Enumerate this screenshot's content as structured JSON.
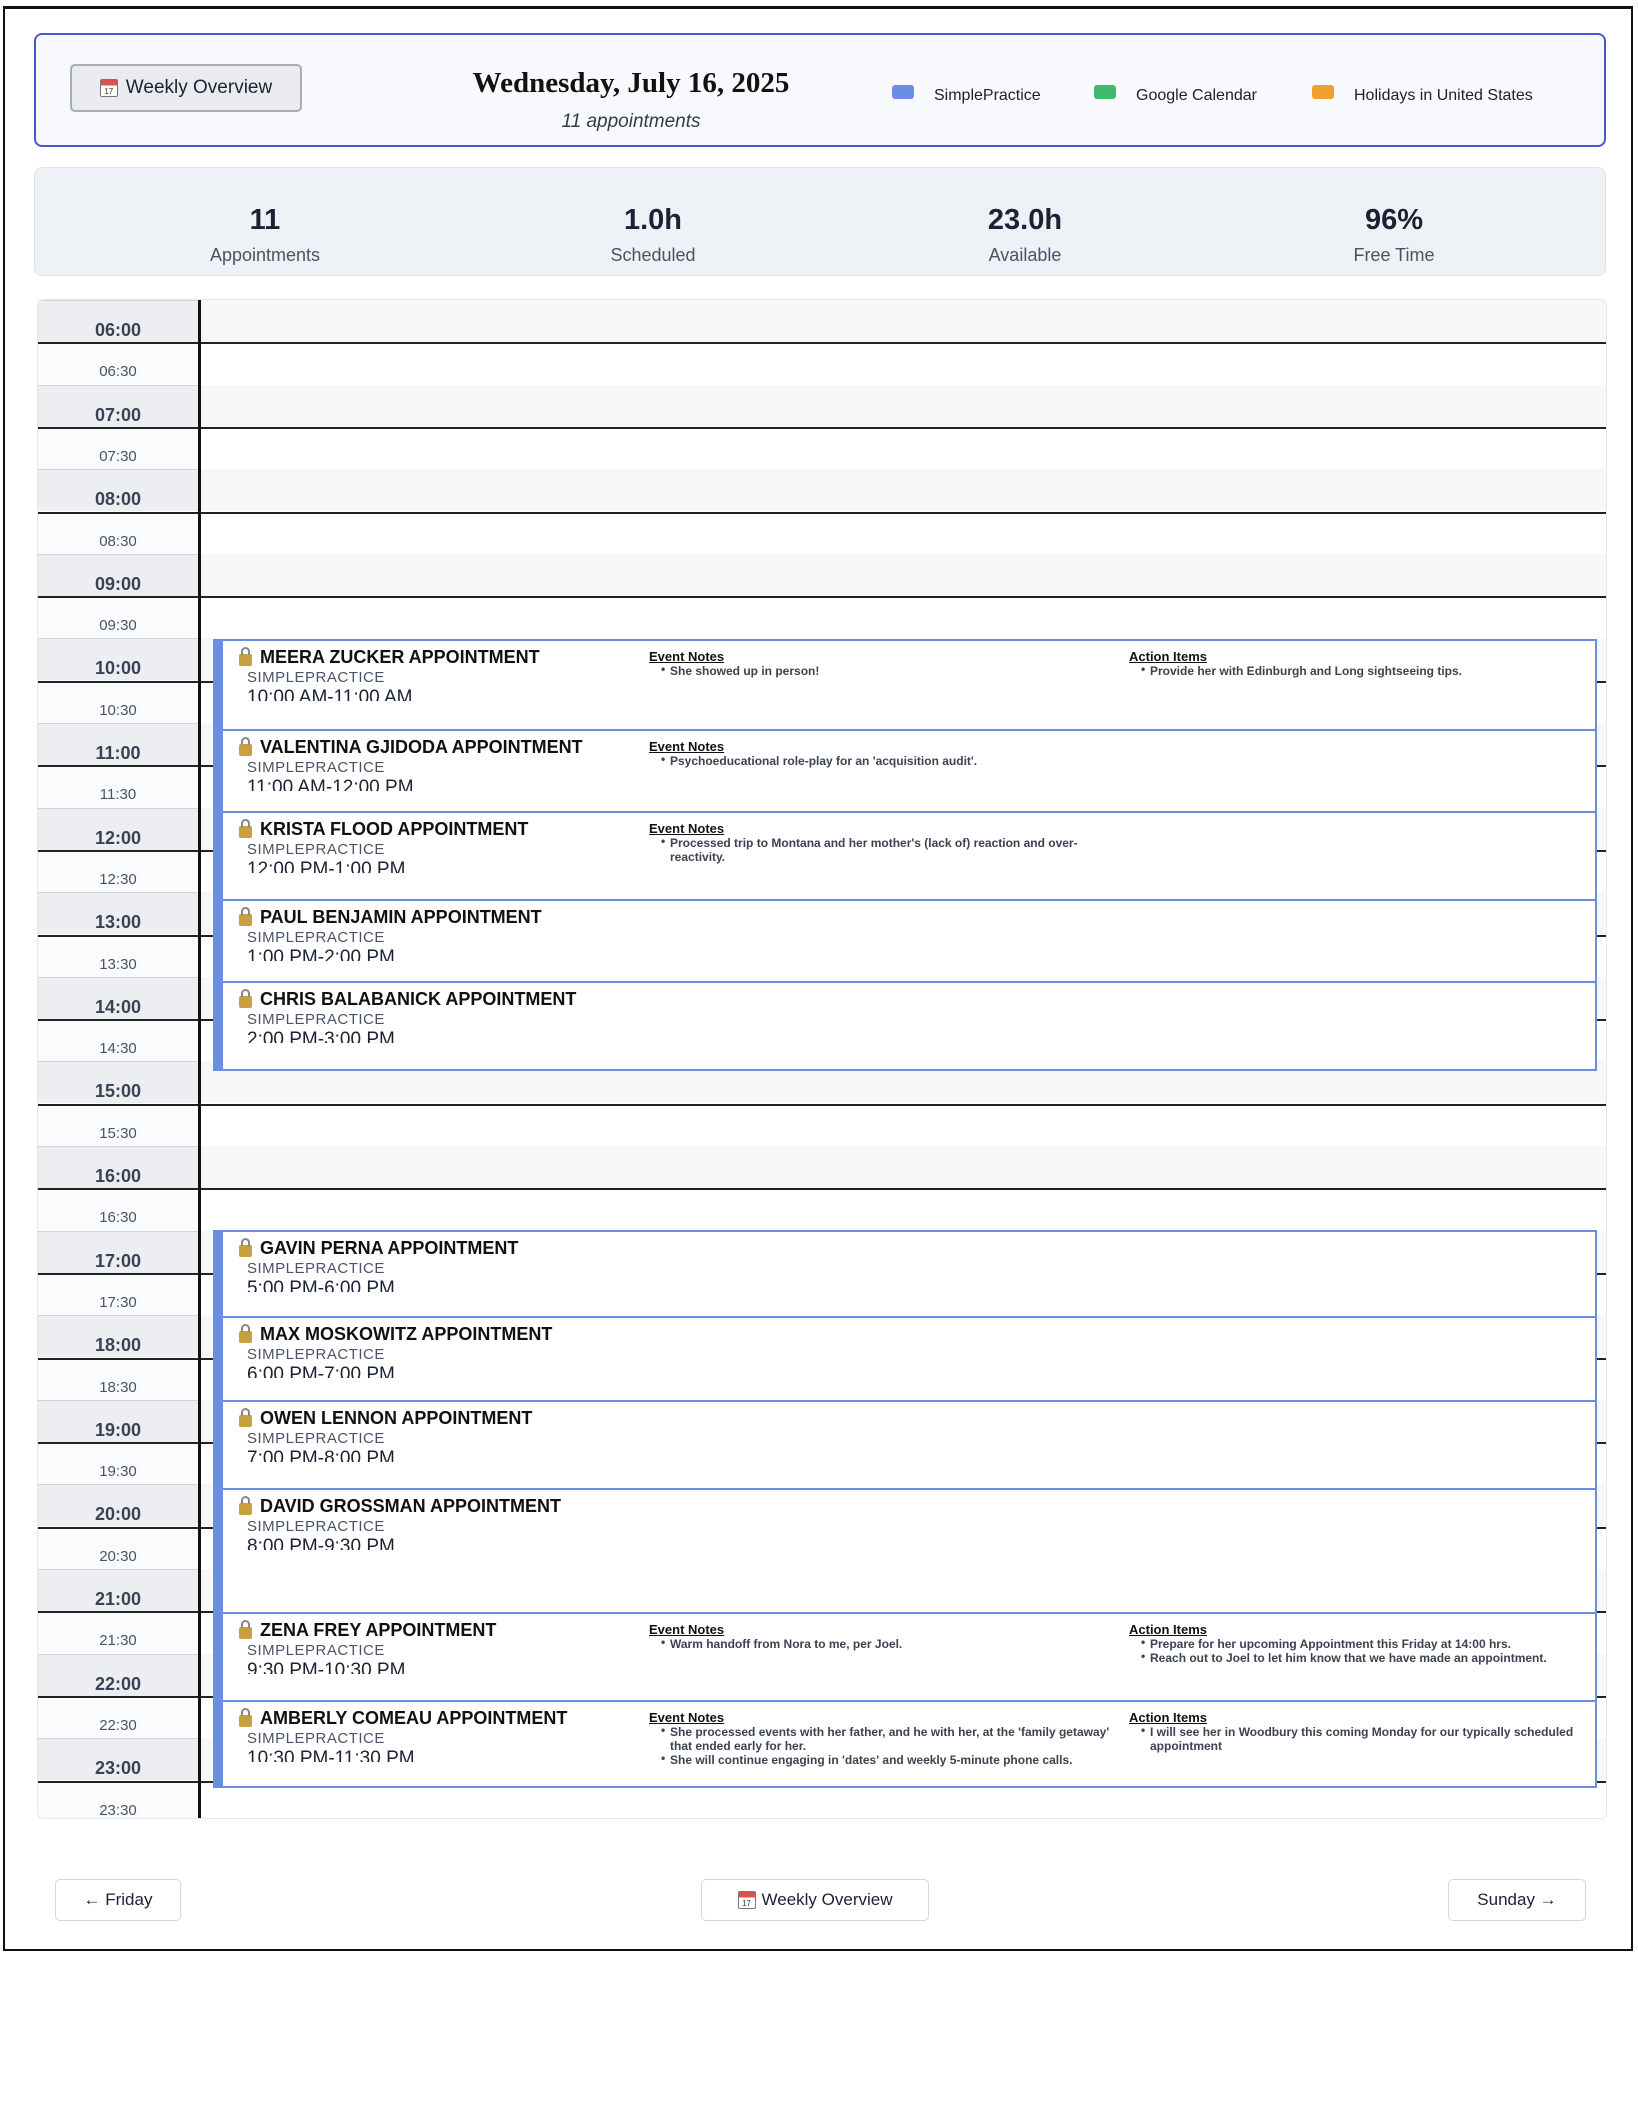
{
  "header": {
    "weekly_overview_label": "Weekly Overview",
    "date_title": "Wednesday, July 16, 2025",
    "appointment_count": "11 appointments",
    "legend": [
      {
        "label": "SimplePractice",
        "color": "#6a8ee6"
      },
      {
        "label": "Google Calendar",
        "color": "#3dba6c"
      },
      {
        "label": "Holidays in United States",
        "color": "#f0a030"
      }
    ]
  },
  "stats": [
    {
      "value": "11",
      "label": "Appointments"
    },
    {
      "value": "1.0h",
      "label": "Scheduled"
    },
    {
      "value": "23.0h",
      "label": "Available"
    },
    {
      "value": "96%",
      "label": "Free Time"
    }
  ],
  "time_slots": [
    "06:00",
    "06:30",
    "07:00",
    "07:30",
    "08:00",
    "08:30",
    "09:00",
    "09:30",
    "10:00",
    "10:30",
    "11:00",
    "11:30",
    "12:00",
    "12:30",
    "13:00",
    "13:30",
    "14:00",
    "14:30",
    "15:00",
    "15:30",
    "16:00",
    "16:30",
    "17:00",
    "17:30",
    "18:00",
    "18:30",
    "19:00",
    "19:30",
    "20:00",
    "20:30",
    "21:00",
    "21:30",
    "22:00",
    "22:30",
    "23:00",
    "23:30"
  ],
  "labels": {
    "event_notes": "Event Notes",
    "action_items": "Action Items"
  },
  "appointments": [
    {
      "title": "MEERA ZUCKER APPOINTMENT",
      "source": "SIMPLEPRACTICE",
      "time": "10:00 AM-11:00 AM",
      "event_notes": [
        "She showed up in person!"
      ],
      "action_items": [
        "Provide her with Edinburgh and Long sightseeing tips."
      ]
    },
    {
      "title": "VALENTINA GJIDODA APPOINTMENT",
      "source": "SIMPLEPRACTICE",
      "time": "11:00 AM-12:00 PM",
      "event_notes": [
        "Psychoeducational role-play for an 'acquisition audit'."
      ],
      "action_items": []
    },
    {
      "title": "KRISTA FLOOD APPOINTMENT",
      "source": "SIMPLEPRACTICE",
      "time": "12:00 PM-1:00 PM",
      "event_notes": [
        "Processed trip to Montana and her mother's (lack of) reaction and over-reactivity."
      ],
      "action_items": []
    },
    {
      "title": "PAUL BENJAMIN APPOINTMENT",
      "source": "SIMPLEPRACTICE",
      "time": "1:00 PM-2:00 PM",
      "event_notes": [],
      "action_items": []
    },
    {
      "title": "CHRIS BALABANICK APPOINTMENT",
      "source": "SIMPLEPRACTICE",
      "time": "2:00 PM-3:00 PM",
      "event_notes": [],
      "action_items": []
    },
    {
      "title": "GAVIN PERNA APPOINTMENT",
      "source": "SIMPLEPRACTICE",
      "time": "5:00 PM-6:00 PM",
      "event_notes": [],
      "action_items": []
    },
    {
      "title": "MAX MOSKOWITZ APPOINTMENT",
      "source": "SIMPLEPRACTICE",
      "time": "6:00 PM-7:00 PM",
      "event_notes": [],
      "action_items": []
    },
    {
      "title": "OWEN LENNON APPOINTMENT",
      "source": "SIMPLEPRACTICE",
      "time": "7:00 PM-8:00 PM",
      "event_notes": [],
      "action_items": []
    },
    {
      "title": "DAVID GROSSMAN APPOINTMENT",
      "source": "SIMPLEPRACTICE",
      "time": "8:00 PM-9:30 PM",
      "event_notes": [],
      "action_items": []
    },
    {
      "title": "ZENA FREY APPOINTMENT",
      "source": "SIMPLEPRACTICE",
      "time": "9:30 PM-10:30 PM",
      "event_notes": [
        "Warm handoff from Nora to me, per Joel."
      ],
      "action_items": [
        "Prepare for her upcoming Appointment this Friday at 14:00 hrs.",
        "Reach out to Joel to let him know that we have made an appointment."
      ]
    },
    {
      "title": "AMBERLY COMEAU APPOINTMENT",
      "source": "SIMPLEPRACTICE",
      "time": "10:30 PM-11:30 PM",
      "event_notes": [
        "She processed events with her father, and he with her, at the 'family getaway' that ended early for her.",
        "She will continue engaging in 'dates' and weekly 5-minute phone calls."
      ],
      "action_items": [
        "I will see her in Woodbury this coming Monday for our typically scheduled appointment"
      ]
    }
  ],
  "footer": {
    "prev_label": "← Friday",
    "weekly_overview_label": "Weekly Overview",
    "next_label": "Sunday →"
  }
}
